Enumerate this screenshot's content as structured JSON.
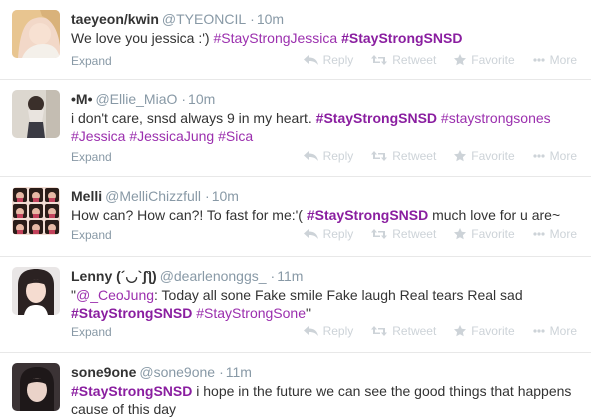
{
  "tweets": [
    {
      "name": "taeyeon/kwin",
      "handle": "@TYEONCIL",
      "time": "10m",
      "segments": [
        {
          "t": "We love you jessica :') ",
          "k": "text"
        },
        {
          "t": "#StayStrongJessica",
          "k": "tag"
        },
        {
          "t": " ",
          "k": "text"
        },
        {
          "t": "#StayStrongSNSD",
          "k": "tagb"
        }
      ]
    },
    {
      "name": "•M•",
      "handle": "@Ellie_MiaO",
      "time": "10m",
      "segments": [
        {
          "t": "i don't care, snsd always 9 in my heart. ",
          "k": "text"
        },
        {
          "t": "#StayStrongSNSD",
          "k": "tagb"
        },
        {
          "t": " ",
          "k": "text"
        },
        {
          "t": "#staystrongsones",
          "k": "tag"
        },
        {
          "t": " ",
          "k": "text"
        },
        {
          "t": "#Jessica",
          "k": "tag"
        },
        {
          "t": " ",
          "k": "text"
        },
        {
          "t": "#JessicaJung",
          "k": "tag"
        },
        {
          "t": " ",
          "k": "text"
        },
        {
          "t": "#Sica",
          "k": "tag"
        }
      ]
    },
    {
      "name": "Melli",
      "handle": "@MelliChizzfull",
      "time": "10m",
      "segments": [
        {
          "t": "How can? How can?! To fast for me:'( ",
          "k": "text"
        },
        {
          "t": "#StayStrongSNSD",
          "k": "tagb"
        },
        {
          "t": " much love for u are~",
          "k": "text"
        }
      ]
    },
    {
      "name": "Lenny (´◡`ʃƪ)",
      "handle": "@dearlenonggs_",
      "time": "11m",
      "segments": [
        {
          "t": "\"",
          "k": "text"
        },
        {
          "t": "@_CeoJung",
          "k": "mention"
        },
        {
          "t": ": Today all sone Fake smile Fake laugh Real tears Real sad ",
          "k": "text"
        },
        {
          "t": "#StayStrongSNSD",
          "k": "tagb"
        },
        {
          "t": " ",
          "k": "text"
        },
        {
          "t": "#StayStrongSone",
          "k": "tag"
        },
        {
          "t": "\"",
          "k": "text"
        }
      ]
    },
    {
      "name": "sone9one",
      "handle": "@sone9one",
      "time": "11m",
      "segments": [
        {
          "t": "#StayStrongSNSD",
          "k": "tagb"
        },
        {
          "t": " i hope in the future we can see the good things that happens cause of this day",
          "k": "text"
        }
      ]
    }
  ],
  "labels": {
    "dot": "·",
    "expand": "Expand",
    "reply": "Reply",
    "retweet": "Retweet",
    "favorite": "Favorite",
    "more": "More"
  },
  "colors": {
    "hashtag": "#9b2fae",
    "meta": "#8899a6",
    "action": "#cdd3d8"
  },
  "icons": {
    "reply": "reply-icon",
    "retweet": "retweet-icon",
    "favorite": "star-icon",
    "more": "more-dots-icon"
  }
}
